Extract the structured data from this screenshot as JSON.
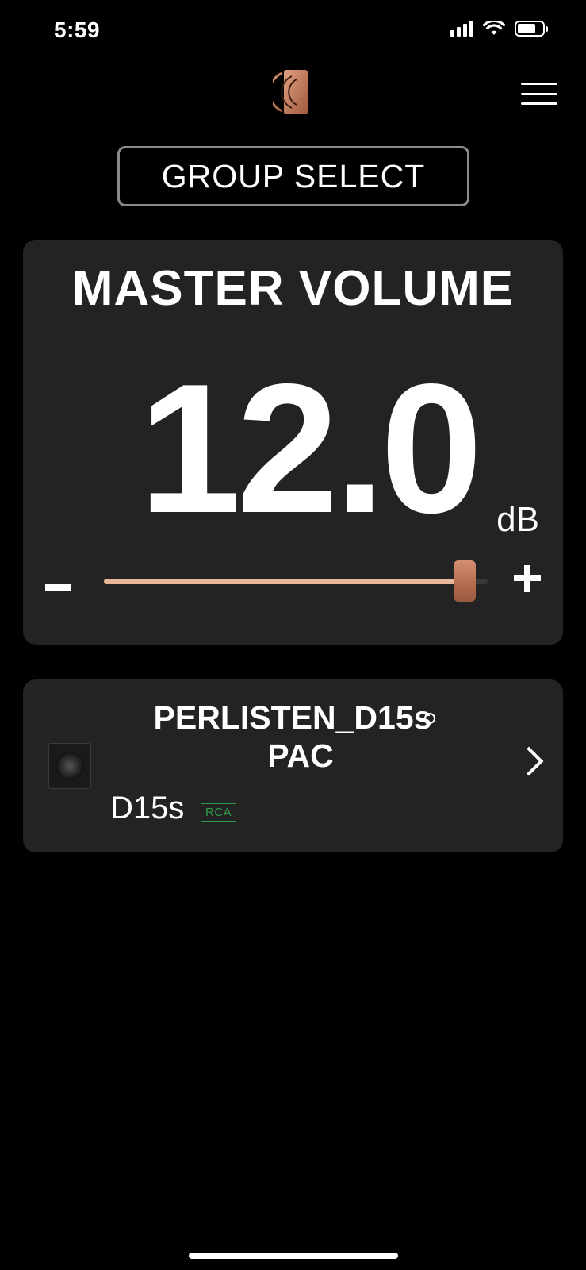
{
  "status_bar": {
    "time": "5:59",
    "icons": [
      "signal-icon",
      "wifi-icon",
      "battery-icon"
    ]
  },
  "header": {
    "logo": "perlisten-logo",
    "menu_icon": "hamburger-menu-icon"
  },
  "group_select": {
    "label": "GROUP SELECT"
  },
  "master_volume": {
    "title": "MASTER VOLUME",
    "value": "12.0",
    "unit": "dB",
    "slider_level": 0.94,
    "minus_label": "-",
    "plus_label": "+"
  },
  "device": {
    "name_line1": "PERLISTEN_D15s",
    "name_line2": "PAC",
    "model": "D15s",
    "input_badge": "RCA",
    "thumb_icon": "subwoofer-icon",
    "chevron_icon": "chevron-right-icon"
  },
  "colors": {
    "accent": "#e8b79a",
    "thumb": "#b26a4d",
    "card": "#232323",
    "badge": "#2e9a4b"
  }
}
